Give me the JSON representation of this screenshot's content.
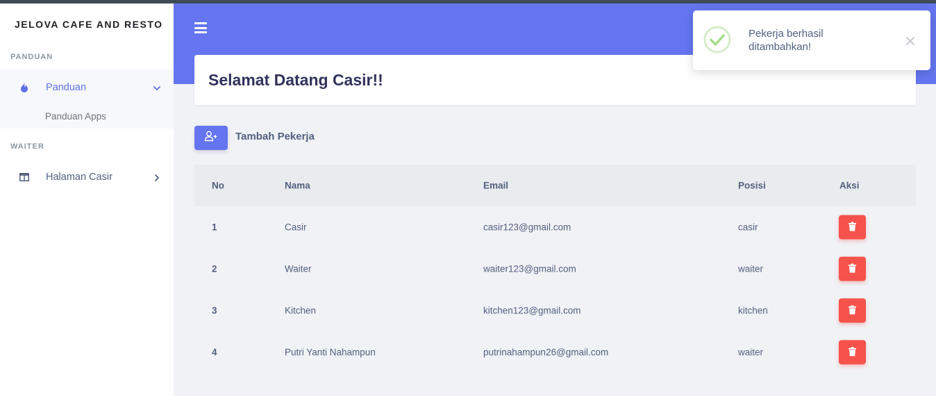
{
  "sidebar": {
    "brand": "JELOVA CAFE AND RESTO",
    "sections": [
      {
        "title": "PANDUAN"
      },
      {
        "title": "WAITER"
      }
    ],
    "items": [
      {
        "label": "Panduan",
        "icon": "fire-icon",
        "expanded": true
      },
      {
        "label": "Halaman Casir",
        "icon": "columns-icon",
        "expanded": false
      }
    ],
    "subitems": [
      {
        "label": "Panduan Apps"
      }
    ]
  },
  "header": {
    "welcome": "Selamat Datang Casir!!"
  },
  "actions": {
    "add_label": "Tambah Pekerja"
  },
  "table": {
    "columns": [
      "No",
      "Nama",
      "Email",
      "Posisi",
      "Aksi"
    ],
    "rows": [
      {
        "no": "1",
        "nama": "Casir",
        "email": "casir123@gmail.com",
        "posisi": "casir"
      },
      {
        "no": "2",
        "nama": "Waiter",
        "email": "waiter123@gmail.com",
        "posisi": "waiter"
      },
      {
        "no": "3",
        "nama": "Kitchen",
        "email": "kitchen123@gmail.com",
        "posisi": "kitchen"
      },
      {
        "no": "4",
        "nama": "Putri Yanti Nahampun",
        "email": "putrinahampun26@gmail.com",
        "posisi": "waiter"
      }
    ]
  },
  "toast": {
    "message": "Pekerja berhasil ditambahkan!",
    "icon": "check-circle-icon"
  },
  "colors": {
    "primary": "#6475ef",
    "danger": "#f5534b",
    "success": "#a5dc86"
  }
}
